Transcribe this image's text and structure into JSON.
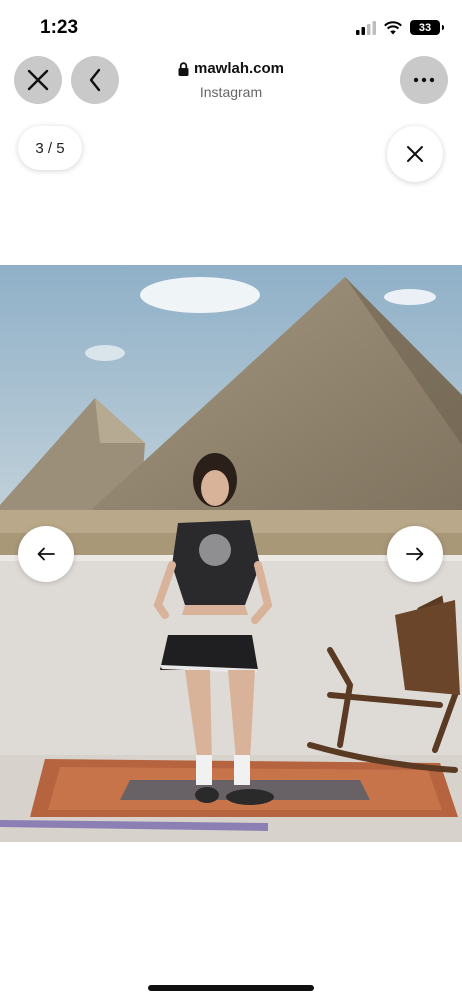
{
  "status": {
    "time": "1:23",
    "battery": "33"
  },
  "browser": {
    "domain": "mawlah.com",
    "subtitle": "Instagram"
  },
  "gallery": {
    "counter": "3 / 5",
    "current": 3,
    "total": 5
  },
  "icons": {
    "close": "close-icon",
    "back": "chevron-left-icon",
    "more": "more-icon",
    "lock": "lock-icon",
    "prev": "arrow-left-icon",
    "next": "arrow-right-icon"
  }
}
